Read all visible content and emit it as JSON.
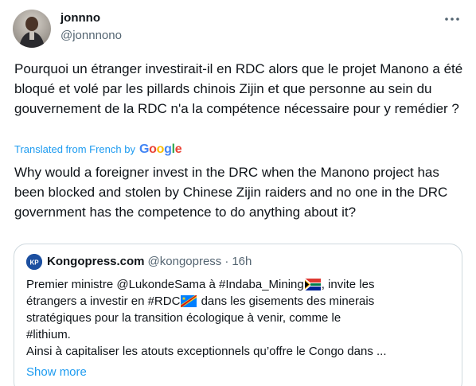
{
  "author": {
    "display_name": "jonnno",
    "handle": "@jonnnono",
    "avatar_icon": "avatar-photo"
  },
  "more_icon": "more-horizontal-icon",
  "tweet": {
    "original_text": "Pourquoi un étranger investirait-il en RDC alors que le projet Manono a été bloqué et volé par les pillards chinois Zijin et que personne au sein du gouvernement de la RDC n'a la compétence nécessaire pour y remédier ?",
    "translated_label": "Translated from French by",
    "translator_logo": "Google",
    "translation_text": "Why would a foreigner invest in the DRC when the Manono project has been blocked and stolen by Chinese Zijin raiders and no one in the DRC government has the competence to do anything about it?"
  },
  "quote": {
    "avatar_icon": "kongopress-logo-icon",
    "avatar_text": "KP",
    "display_name": "Kongopress.com",
    "handle": "@kongopress",
    "separator": "·",
    "time": "16h",
    "line1_a": "Premier ministre @LukondeSama à #Indaba_Mining",
    "line1_b": ", invite les",
    "line2_a": "étrangers a investir en #RDC",
    "line2_b": " dans les gisements des minerais",
    "line3": "stratégiques pour la transition écologique à venir, comme le",
    "line4": "#lithium.",
    "line5": "Ainsi à capitaliser les atouts exceptionnels qu’offre le Congo dans ...",
    "flag_1": "south-africa-flag-icon",
    "flag_2": "drc-flag-icon",
    "show_more": "Show more"
  },
  "colors": {
    "accent": "#1d9bf0",
    "text": "#0f1419",
    "secondary": "#536471",
    "border": "#cfd9de"
  }
}
